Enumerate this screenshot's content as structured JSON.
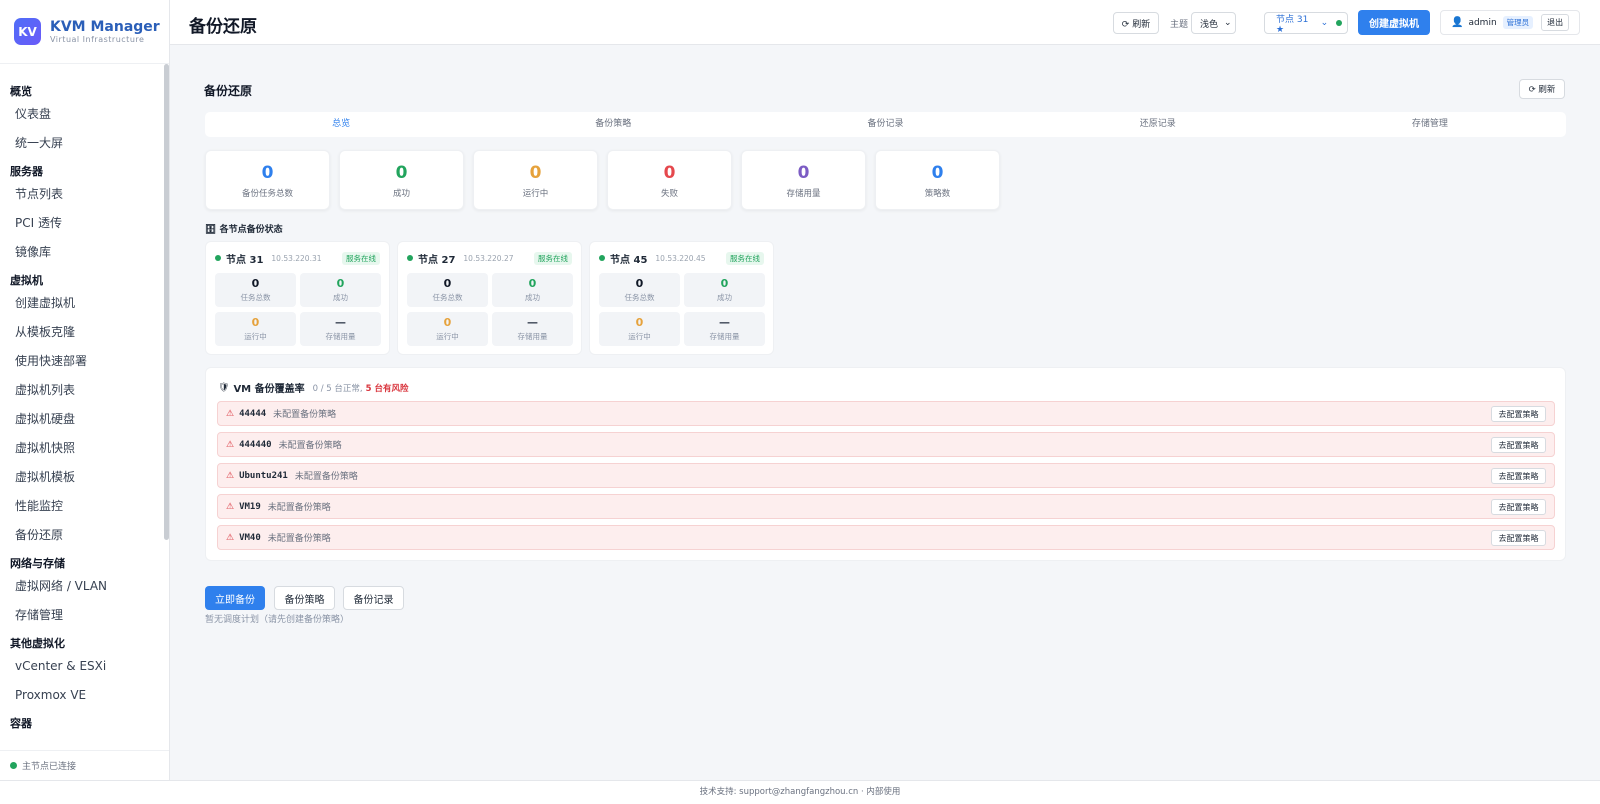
{
  "brand": {
    "logo": "KV",
    "name": "KVM Manager",
    "subtitle": "Virtual Infrastructure"
  },
  "sidebar": {
    "groups": [
      {
        "title": "概览",
        "items": [
          "仪表盘",
          "统一大屏"
        ]
      },
      {
        "title": "服务器",
        "items": [
          "节点列表",
          "PCI 透传",
          "镜像库"
        ]
      },
      {
        "title": "虚拟机",
        "items": [
          "创建虚拟机",
          "从模板克隆",
          "使用快速部署",
          "虚拟机列表",
          "虚拟机硬盘",
          "虚拟机快照",
          "虚拟机模板",
          "性能监控",
          "备份还原"
        ]
      },
      {
        "title": "网络与存储",
        "items": [
          "虚拟网络 / VLAN",
          "存储管理"
        ]
      },
      {
        "title": "其他虚拟化",
        "items": [
          "vCenter & ESXi",
          "Proxmox VE"
        ]
      },
      {
        "title": "容器",
        "items": []
      }
    ],
    "status": "主节点已连接"
  },
  "header": {
    "title": "备份还原",
    "refresh": "⟳ 刷新",
    "theme_label": "主题",
    "theme_value": "浅色",
    "node": "节点 31 ★",
    "create_vm": "创建虚拟机",
    "user": "admin",
    "role": "管理员",
    "logout": "退出"
  },
  "main": {
    "section_title": "备份还原",
    "refresh": "⟳ 刷新",
    "tabs": [
      "总览",
      "备份策略",
      "备份记录",
      "还原记录",
      "存储管理"
    ],
    "stats": [
      {
        "value": "0",
        "label": "备份任务总数",
        "color": "#2f80ed"
      },
      {
        "value": "0",
        "label": "成功",
        "color": "#22a45d"
      },
      {
        "value": "0",
        "label": "运行中",
        "color": "#e6a23c"
      },
      {
        "value": "0",
        "label": "失败",
        "color": "#e5484d"
      },
      {
        "value": "0",
        "label": "存储用量",
        "color": "#7c5cc4"
      },
      {
        "value": "0",
        "label": "策略数",
        "color": "#2f80ed"
      }
    ],
    "node_status_title": "各节点备份状态",
    "nodes": [
      {
        "name": "节点 31",
        "ip": "10.53.220.31",
        "status": "服务在线",
        "total": "0",
        "total_label": "任务总数",
        "success": "0",
        "success_label": "成功",
        "running": "0",
        "running_label": "运行中",
        "storage": "—",
        "storage_label": "存储用量"
      },
      {
        "name": "节点 27",
        "ip": "10.53.220.27",
        "status": "服务在线",
        "total": "0",
        "total_label": "任务总数",
        "success": "0",
        "success_label": "成功",
        "running": "0",
        "running_label": "运行中",
        "storage": "—",
        "storage_label": "存储用量"
      },
      {
        "name": "节点 45",
        "ip": "10.53.220.45",
        "status": "服务在线",
        "total": "0",
        "total_label": "任务总数",
        "success": "0",
        "success_label": "成功",
        "running": "0",
        "running_label": "运行中",
        "storage": "—",
        "storage_label": "存储用量"
      }
    ],
    "coverage": {
      "title": "VM 备份覆盖率",
      "summary": "0 / 5 台正常,",
      "risk": "5 台有风险",
      "rows": [
        {
          "vm": "44444",
          "msg": "未配置备份策略",
          "action": "去配置策略"
        },
        {
          "vm": "444440",
          "msg": "未配置备份策略",
          "action": "去配置策略"
        },
        {
          "vm": "Ubuntu241",
          "msg": "未配置备份策略",
          "action": "去配置策略"
        },
        {
          "vm": "VM19",
          "msg": "未配置备份策略",
          "action": "去配置策略"
        },
        {
          "vm": "VM40",
          "msg": "未配置备份策略",
          "action": "去配置策略"
        }
      ]
    },
    "actions": {
      "backup_now": "立即备份",
      "policies": "备份策略",
      "records": "备份记录"
    },
    "schedule_note": "暂无调度计划（请先创建备份策略）"
  },
  "footer": "技术支持: support@zhangfangzhou.cn · 内部使用"
}
